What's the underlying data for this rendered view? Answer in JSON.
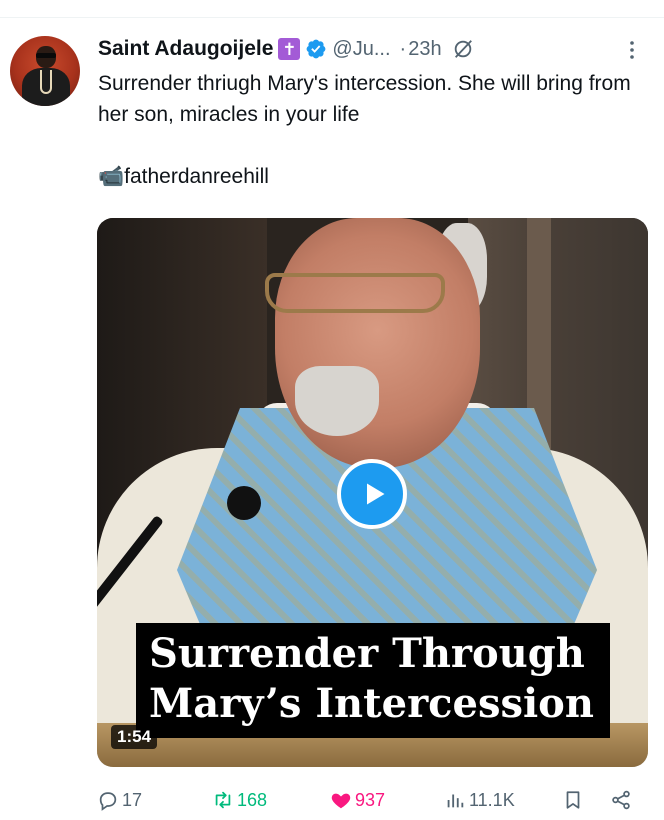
{
  "author": {
    "display_name": "Saint Adaugoijele",
    "badge_glyph": "✝",
    "handle": "@Ju...",
    "separator": "·",
    "time": "23h",
    "verified_color": "#1d9bf0",
    "badge_color": "#a35bd6"
  },
  "tweet": {
    "text": "Surrender thriugh Mary's intercession. She will bring from her son, miracles in your life\n\n📹fatherdanreehill"
  },
  "media": {
    "caption_line1": "Surrender Through",
    "caption_line2": "Mary’s Intercession",
    "duration": "1:54"
  },
  "actions": {
    "replies": "17",
    "reposts": "168",
    "likes": "937",
    "views": "11.1K",
    "repost_color": "#00ba7c",
    "like_color": "#f91880"
  },
  "icons": {
    "more": "more-icon",
    "grok": "grok-icon",
    "reply": "reply-icon",
    "repost": "repost-icon",
    "like": "heart-icon",
    "views": "views-icon",
    "bookmark": "bookmark-icon",
    "share": "share-icon",
    "play": "play-icon",
    "verified": "verified-icon"
  }
}
